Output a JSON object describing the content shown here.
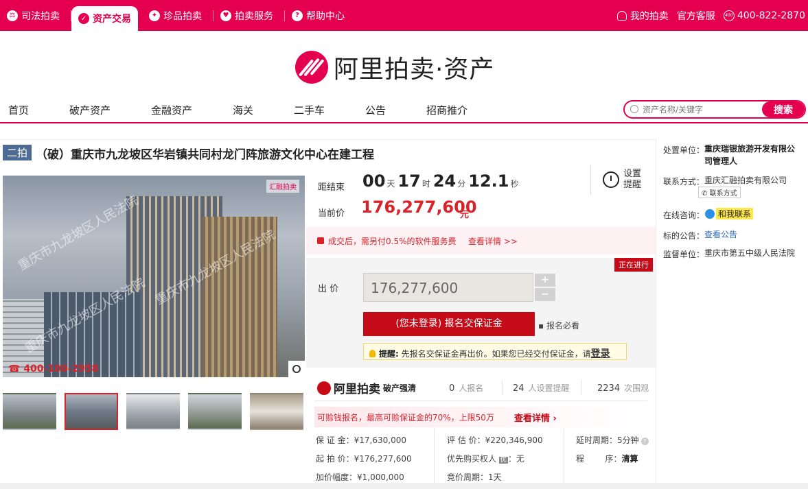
{
  "topbar": {
    "items": [
      {
        "label": "司法拍卖",
        "icon": "gavel-icon"
      },
      {
        "label": "资产交易",
        "icon": "asset-icon",
        "active": true
      },
      {
        "label": "珍品拍卖",
        "icon": "gem-icon"
      },
      {
        "label": "拍卖服务",
        "icon": "heart-icon"
      },
      {
        "label": "帮助中心",
        "icon": "help-icon"
      }
    ],
    "my_auction": "我的拍卖",
    "service": "官方客服",
    "phone_badge": "400",
    "phone": "400-822-2870"
  },
  "logo": {
    "text": "阿里拍卖·资产"
  },
  "mainnav": [
    "首页",
    "破产资产",
    "金融资产",
    "海关",
    "二手车",
    "公告",
    "招商推介"
  ],
  "search": {
    "placeholder": "资产名称/关键字",
    "button": "搜索"
  },
  "item": {
    "tag": "二拍",
    "title": "（破）重庆市九龙坡区华岩镇共同村龙门阵旅游文化中心在建工程",
    "watermarks": [
      "重庆市九龙坡区人民法院",
      "重庆市九龙坡区人民法院",
      "重庆市九龙坡区人民法院"
    ],
    "photo_badge": "汇融拍卖",
    "photo_phone": "☎ 400-100-2958"
  },
  "countdown": {
    "label": "距结束",
    "days": "00",
    "days_unit": "天",
    "hours": "17",
    "hours_unit": "时",
    "mins": "24",
    "mins_unit": "分",
    "secs": "12.1",
    "secs_unit": "秒"
  },
  "price": {
    "label": "当前价",
    "value": "176,277,600",
    "unit": "元"
  },
  "remind": {
    "label": "设置提醒"
  },
  "fee": {
    "text": "成交后，需另付0.5%的软件服务费",
    "link": "查看详情 >>"
  },
  "status": "正在进行",
  "bid": {
    "label": "出 价",
    "value": "176,277,600",
    "plus": "+",
    "minus": "−",
    "signup": "(您未登录) 报名交保证金",
    "must_read": "报名必看",
    "tip_prefix": "提醒:",
    "tip_text": " 先报名交保证金再出价。如果您已经交付保证金，请",
    "tip_login": "登录"
  },
  "stats": {
    "brand": "阿里拍卖",
    "brand_sub": "破产强清",
    "signups": "0",
    "signups_label": "人报名",
    "reminders": "24",
    "reminders_label": "人设置提醒",
    "views": "2234",
    "views_label": "次围观"
  },
  "promo": {
    "text": "可赊钱报名，最高可赊保证金的70%，上限50万",
    "link": "查看详情 ›"
  },
  "details": {
    "deposit": "保 证 金：¥17,630,000",
    "start": "起 拍 价：¥176,277,600",
    "increment": "加价幅度：¥1,000,000",
    "appraisal": "评 估 价：¥220,346,900",
    "priority": "优先购买权人",
    "priority_icon": "优",
    "priority_value": "：无",
    "cycle": "竞价周期：1天",
    "delay": "延时周期：5分钟",
    "procedure_label": "程        序：",
    "procedure_value": "清算"
  },
  "right": {
    "disposer_label": "处置单位：",
    "disposer": "重庆瑞银旅游开发有限公司管理人",
    "contact_label": "联系方式：",
    "contact": "重庆汇融拍卖有限公司",
    "contact_chip": "联系方式",
    "online_label": "在线咨询：",
    "online": "和我联系",
    "notice_label": "标的公告：",
    "notice": "查看公告",
    "supervisor_label": "监督单位：",
    "supervisor": "重庆市第五中级人民法院"
  }
}
